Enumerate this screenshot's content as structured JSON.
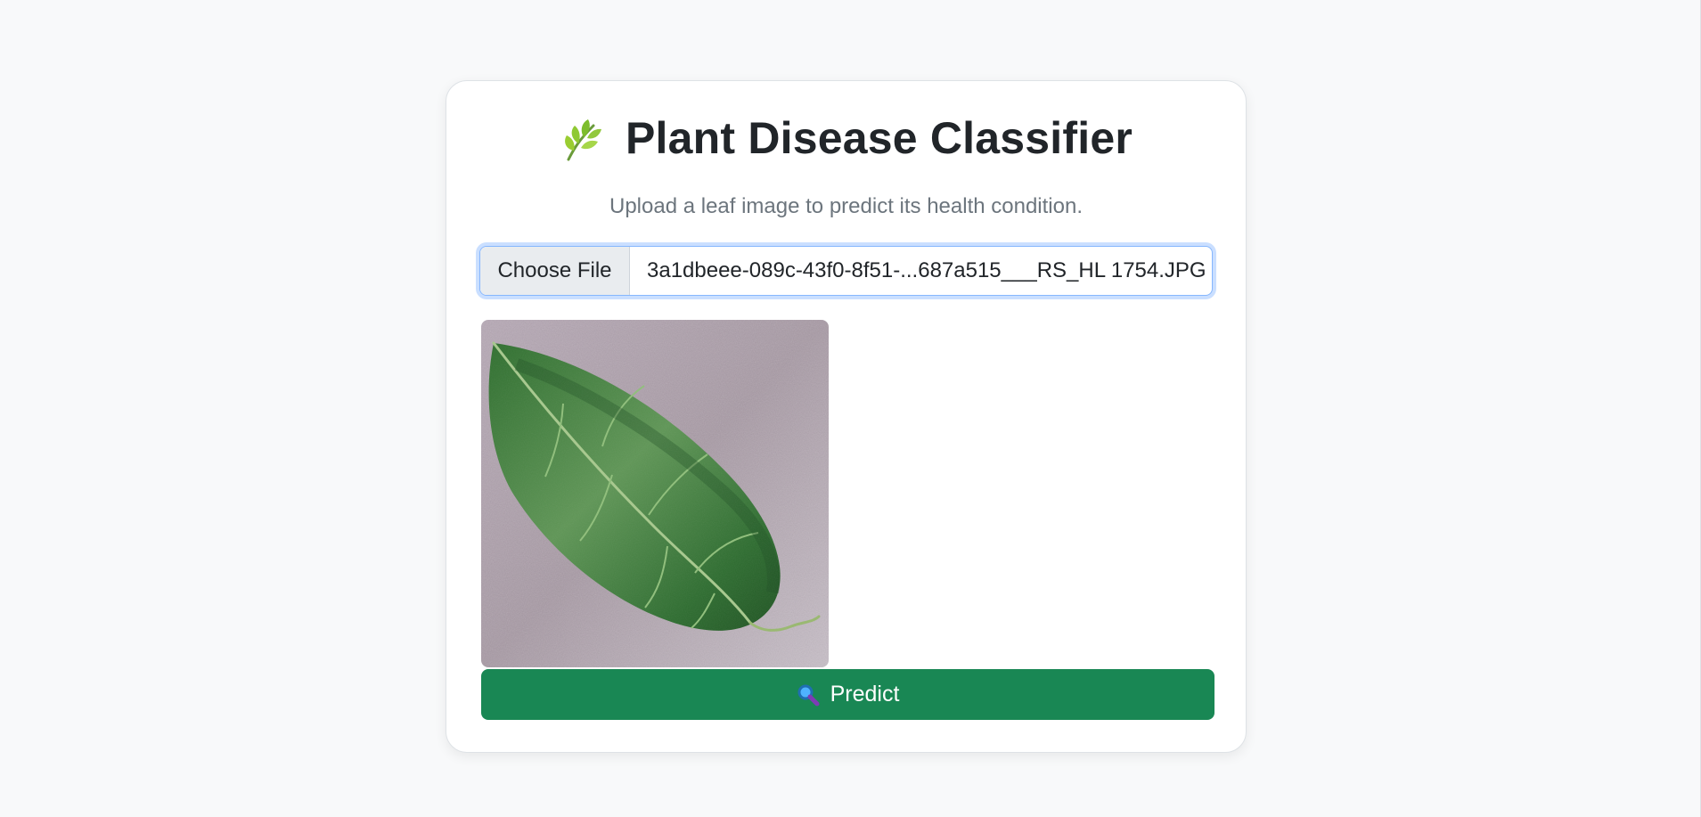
{
  "header": {
    "title": "Plant Disease Classifier",
    "icon": "herb-leaf-icon"
  },
  "subtitle": "Upload a leaf image to predict its health condition.",
  "file_input": {
    "button_label": "Choose File",
    "file_name": "3a1dbeee-089c-43f0-8f51-...687a515___RS_HL 1754.JPG"
  },
  "preview": {
    "description_icon": "leaf-photo"
  },
  "predict_button": {
    "label": "Predict",
    "icon": "magnifier-icon"
  },
  "colors": {
    "page_background": "#f8f9fa",
    "primary_action": "#198754",
    "focus_ring": "#86b7fe",
    "title_text": "#212529",
    "muted_text": "#6c757d"
  }
}
